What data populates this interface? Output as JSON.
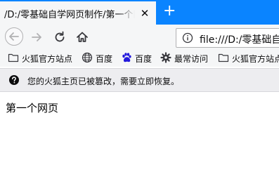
{
  "tab": {
    "title": "/D:/零基础自学网页制作/第一个网",
    "close_glyph": "✕"
  },
  "new_tab_glyph": "+",
  "urlbar": {
    "text": "file:///D:/零基础自"
  },
  "bookmarks": [
    {
      "label": "火狐官方站点",
      "icon": "folder-icon"
    },
    {
      "label": "百度",
      "icon": "globe-icon"
    },
    {
      "label": "百度",
      "icon": "paw-icon"
    },
    {
      "label": "最常访问",
      "icon": "gear-icon"
    },
    {
      "label": "火狐官方站点",
      "icon": "folder-icon"
    }
  ],
  "notification": {
    "text": "您的火狐主页已被篡改，需要立即恢复。",
    "icon": "question-icon"
  },
  "page": {
    "content": "第一个网页"
  },
  "colors": {
    "tab_strip": "#0a84ff",
    "toolbar": "#f5f6f7",
    "notice_bar": "#ededf0"
  }
}
